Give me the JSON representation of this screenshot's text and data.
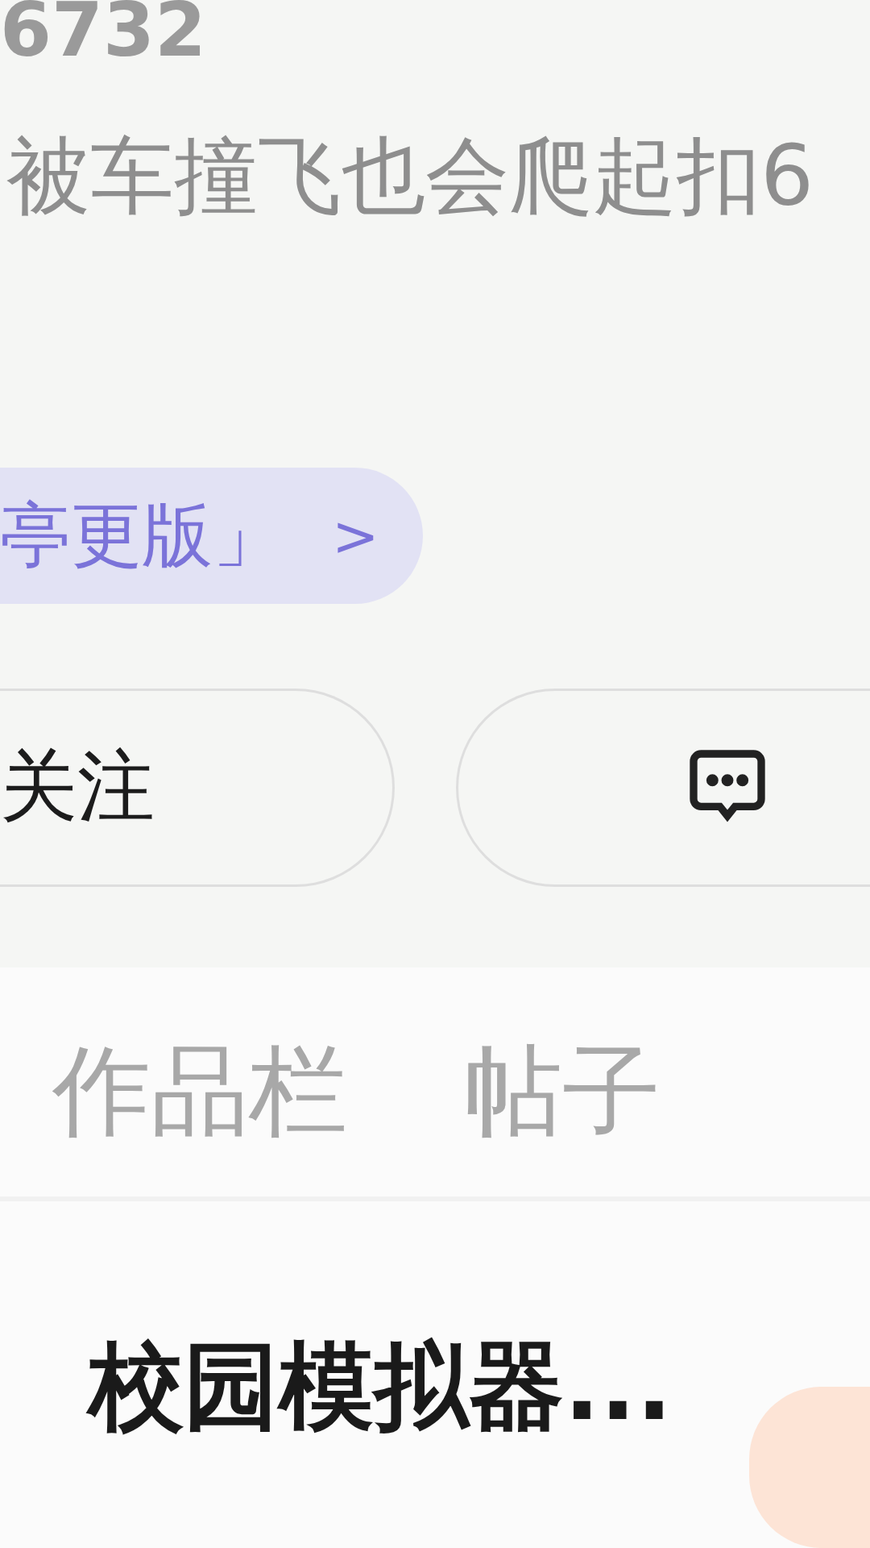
{
  "profile": {
    "id_fragment": "6732",
    "bio": "被车撞飞也会爬起扣6"
  },
  "link_pill": {
    "label": "亭更版」",
    "arrow": ">"
  },
  "actions": [
    {
      "kind": "follow",
      "label": "关注"
    },
    {
      "kind": "message"
    }
  ],
  "tabs": [
    {
      "label": "作品栏",
      "selected": false
    },
    {
      "label": "帖子",
      "selected": false
    }
  ],
  "items": [
    {
      "title": "校园模拟器..."
    }
  ]
}
